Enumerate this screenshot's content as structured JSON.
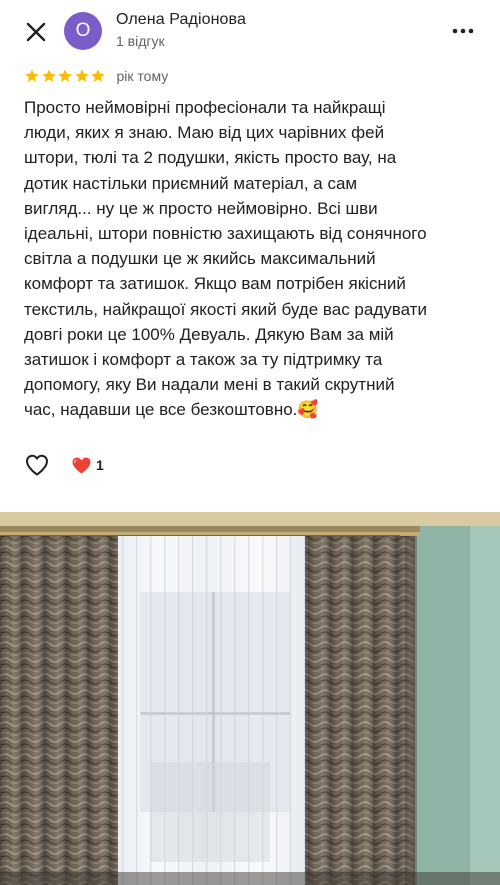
{
  "header": {
    "avatar_letter": "О",
    "reviewer_name": "Олена Радіонова",
    "reviewer_meta": "1 відгук",
    "close_icon": "close-icon",
    "more_icon": "more-vertical-icon"
  },
  "review": {
    "rating": 5,
    "max_rating": 5,
    "time": "рік тому",
    "text": "Просто неймовірні професіонали та найкращі\nлюди, яких я знаю. Маю від цих чарівних фей\nштори, тюлі та 2 подушки, якість просто вау, на\nдотик настільки приємний матеріал, а сам\nвигляд... ну це ж просто неймовірно. Всі шви\nідеальні, штори повністю захищають від сонячного\nсвітла а подушки це ж якийсь максимальний\nкомфорт та затишок. Якщо вам потрібен якісний\nтекстиль, найкращої якості який буде вас радувати\nдовгі роки це 100% Девуаль. Дякую Вам за мій\nзатишок і комфорт а також за ту підтримку та\nдопомогу, яку Ви надали мені в такий скрутний\nчас, надавши це все безкоштовно.🥰"
  },
  "actions": {
    "like_icon": "heart-outline-icon",
    "reaction_icon": "red-heart-icon",
    "reaction_count": "1"
  },
  "photo": {
    "subject": "curtains-and-tulle-photo"
  },
  "colors": {
    "avatar_bg": "#7b5cc8",
    "star": "#fbbc04",
    "secondary_text": "#5f6368",
    "heart_red": "#ea4335"
  }
}
